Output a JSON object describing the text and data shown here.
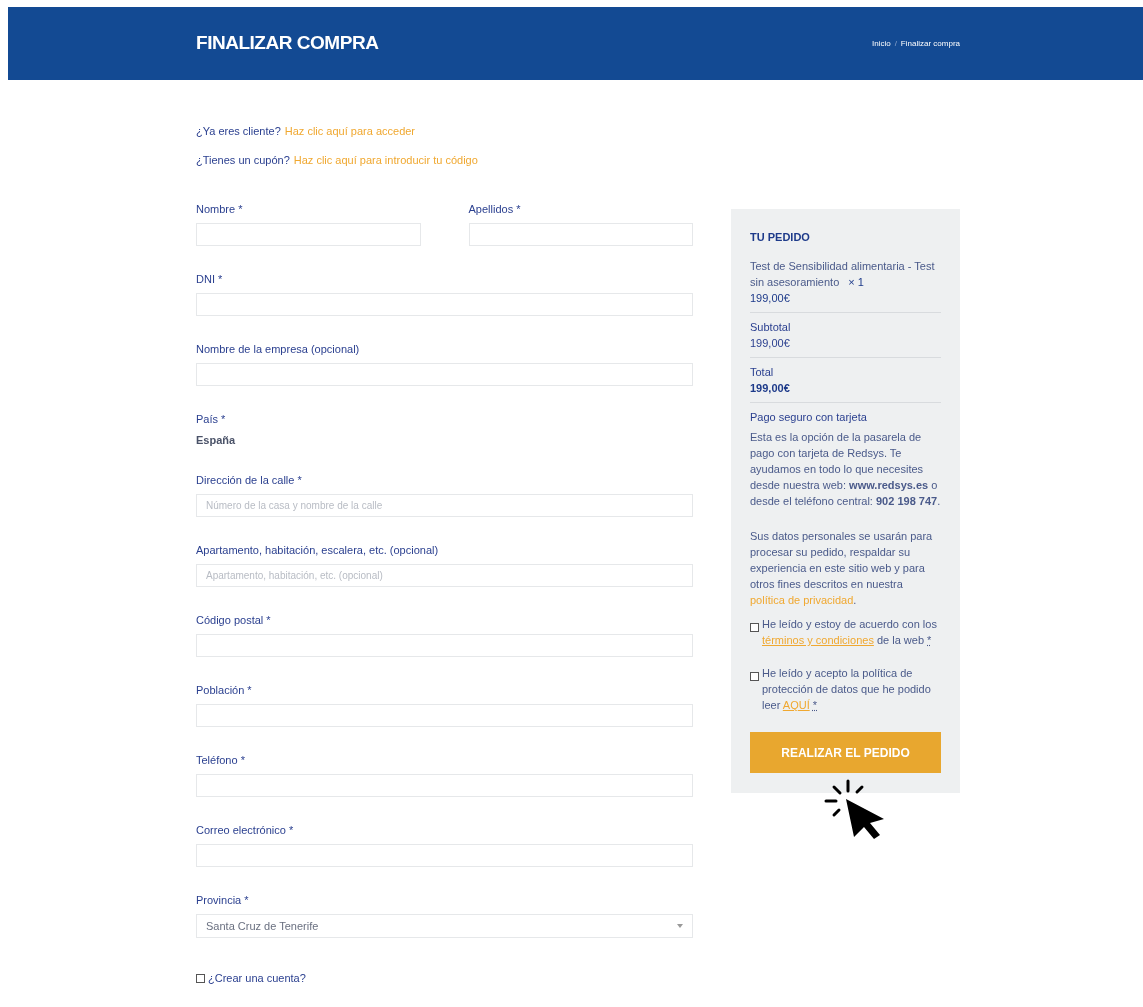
{
  "header": {
    "title": "FINALIZAR COMPRA",
    "breadcrumb": [
      {
        "label": "Inicio"
      },
      {
        "label": "Finalizar compra"
      }
    ],
    "separator": "/"
  },
  "notices": [
    {
      "text": "¿Ya eres cliente?",
      "link": "Haz clic aquí para acceder"
    },
    {
      "text": "¿Tienes un cupón?",
      "link": "Haz clic aquí para introducir tu código"
    }
  ],
  "form_rows": [
    [
      {
        "kind": "input",
        "label": "Nombre *"
      },
      {
        "kind": "input",
        "label": "Apellidos *"
      }
    ],
    [
      {
        "kind": "input",
        "label": "DNI *"
      }
    ],
    [
      {
        "kind": "input",
        "label": "Nombre de la empresa (opcional)"
      }
    ],
    [
      {
        "kind": "static",
        "label": "País *",
        "value": "España"
      }
    ],
    [
      {
        "kind": "input",
        "label": "Dirección de la calle *",
        "placeholder": "Número de la casa y nombre de la calle"
      }
    ],
    [
      {
        "kind": "input",
        "label": "Apartamento, habitación, escalera, etc. (opcional)",
        "placeholder": "Apartamento, habitación, etc. (opcional)"
      }
    ],
    [
      {
        "kind": "input",
        "label": "Código postal *"
      }
    ],
    [
      {
        "kind": "input",
        "label": "Población *"
      }
    ],
    [
      {
        "kind": "input",
        "label": "Teléfono *"
      }
    ],
    [
      {
        "kind": "input",
        "label": "Correo electrónico *"
      }
    ],
    [
      {
        "kind": "select",
        "label": "Provincia *",
        "value": "Santa Cruz de Tenerife"
      }
    ]
  ],
  "create_account": {
    "label": "¿Crear una cuenta?",
    "checked": false
  },
  "order": {
    "title": "TU PEDIDO",
    "item": {
      "name": "Test de Sensibilidad alimentaria - Test sin asesoramiento",
      "quantity": "× 1",
      "price": "199,00€"
    },
    "subtotal": {
      "label": "Subtotal",
      "value": "199,00€"
    },
    "total": {
      "label": "Total",
      "value": "199,00€"
    },
    "payment_title": "Pago seguro con tarjeta",
    "payment_text": "Esta es la opción de la pasarela de pago con tarjeta de Redsys. Te ayudamos en todo lo que necesites desde nuestra web: **www.redsys.es** o desde el teléfono central: **902 198 747**.",
    "privacy_text": "Sus datos personales se usarán para procesar su pedido, respaldar su experiencia en este sitio web y para otros fines descritos en nuestra",
    "privacy_link": "política de privacidad",
    "privacy_end": ".",
    "consents": [
      {
        "text": "He leído y estoy de acuerdo con los",
        "link": "términos y condiciones",
        "after": "de la web",
        "required": "*",
        "checked": false
      },
      {
        "text": "He leído y acepto la política de protección de datos que he podido leer",
        "link": "AQUÍ",
        "required": "*",
        "checked": false
      }
    ],
    "button": "REALIZAR EL PEDIDO"
  }
}
